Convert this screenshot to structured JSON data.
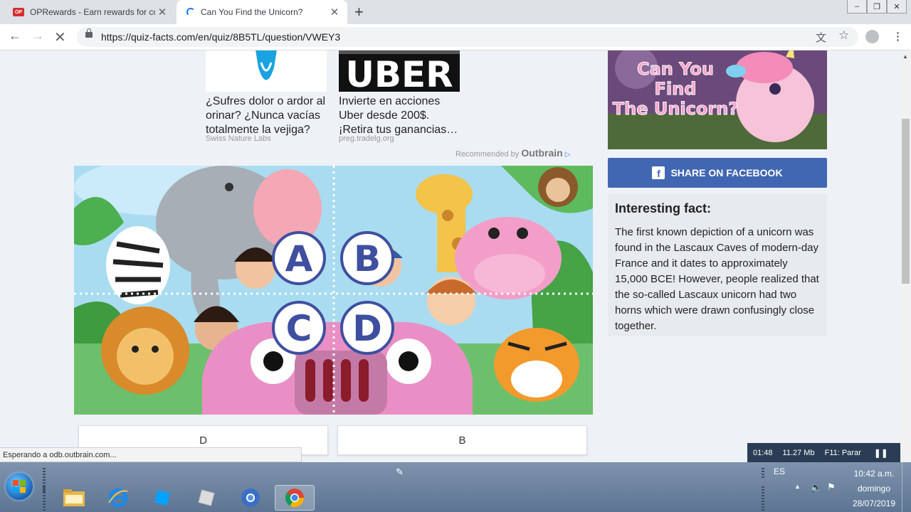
{
  "browser": {
    "tabs": [
      {
        "title": "OPRewards - Earn rewards for co",
        "favicon": "OP",
        "active": false
      },
      {
        "title": "Can You Find the Unicorn?",
        "active": true
      }
    ],
    "close_glyph": "✕",
    "new_tab_glyph": "+",
    "url": "https://quiz-facts.com/en/quiz/8B5TL/question/VWEY3",
    "window_buttons": [
      "–",
      "❐",
      "✕"
    ]
  },
  "page": {
    "ads": [
      {
        "title": "¿Sufres dolor o ardor al orinar? ¿Nunca vacías totalmente la vejiga?",
        "source": "Swiss Nature Labs"
      },
      {
        "title": "Invierte en acciones Uber desde 200$. ¡Retira tus ganancias…",
        "source": "preg.tradelg.org",
        "image_text": "UBER"
      }
    ],
    "recommended_by": "Recommended by",
    "outbrain": "Outbrain",
    "puzzle_letters": [
      "A",
      "B",
      "C",
      "D"
    ],
    "answers": [
      "D",
      "B"
    ],
    "side_banner": [
      "Can You",
      "Find",
      "The Unicorn?"
    ],
    "share_label": "SHARE ON FACEBOOK",
    "fact": {
      "heading": "Interesting fact:",
      "text": "The first known depiction of a unicorn was found in the Lascaux Caves of modern-day France and it dates to approximately 15,000 BCE! However, people realized that the so-called Lascaux unicorn had two horns which were drawn confusingly close together."
    },
    "status": "Esperando a odb.outbrain.com..."
  },
  "recorder": {
    "time": "01:48",
    "size": "11.27 Mb",
    "hint": "F11: Parar"
  },
  "taskbar": {
    "language": "ES",
    "time": "10:42 a.m.",
    "day": "domingo",
    "date": "28/07/2019"
  },
  "colors": {
    "facebook": "#4267b2",
    "badge_blue": "#3f4fa0",
    "accent": "#1a73e8"
  }
}
